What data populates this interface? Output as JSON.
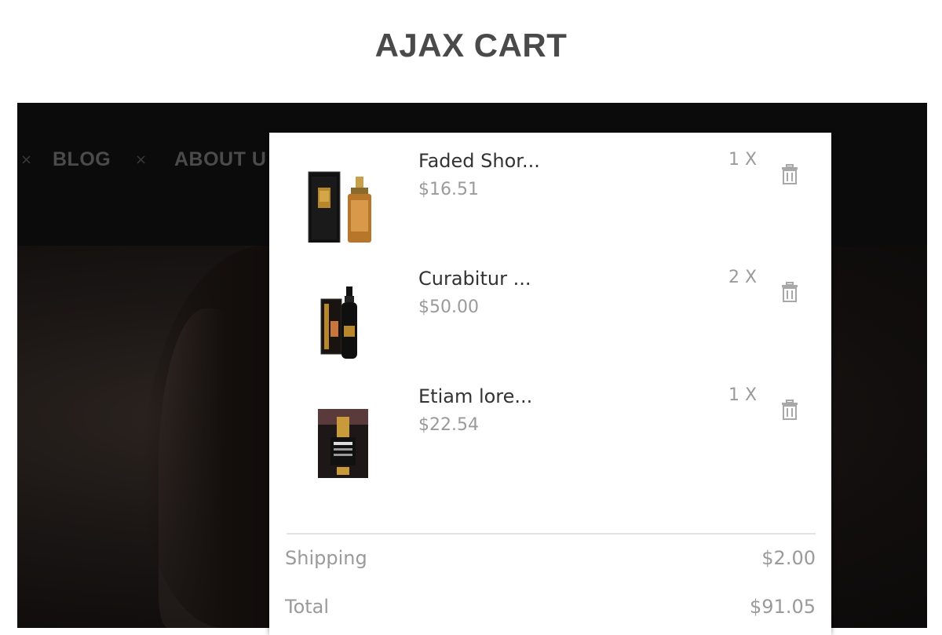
{
  "page": {
    "title": "AJAX CART"
  },
  "nav": {
    "items": [
      {
        "label": "BLOG"
      },
      {
        "label": "ABOUT U"
      }
    ],
    "separator": "×"
  },
  "cart": {
    "items": [
      {
        "name": "Faded Shor...",
        "price": "$16.51",
        "quantity": "1 X",
        "thumb_icon": "perfume-box-bottle-icon"
      },
      {
        "name": "Curabitur ...",
        "price": "$50.00",
        "quantity": "2 X",
        "thumb_icon": "spray-bottle-box-icon"
      },
      {
        "name": "Etiam lore...",
        "price": "$22.54",
        "quantity": "1 X",
        "thumb_icon": "packet-product-icon"
      }
    ],
    "shipping": {
      "label": "Shipping",
      "value": "$2.00"
    },
    "total": {
      "label": "Total",
      "value": "$91.05"
    },
    "delete_icon": "trash-icon"
  },
  "colors": {
    "title": "#4a4a4a",
    "frame_bg": "#0d0b0c",
    "nav_text": "#4b4b4b",
    "panel_bg": "#ffffff",
    "muted_text": "#9a9a9a",
    "item_name": "#333333",
    "gold": "#b8862b"
  }
}
